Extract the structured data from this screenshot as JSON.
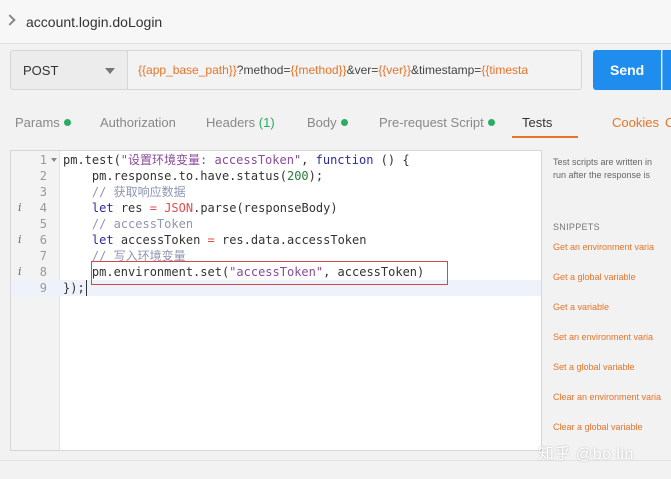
{
  "request": {
    "name": "account.login.doLogin"
  },
  "url_bar": {
    "method": "POST",
    "url_segments": [
      {
        "text": "{{app_base_path}}",
        "var": true
      },
      {
        "text": "?method=",
        "var": false
      },
      {
        "text": "{{method}}",
        "var": true
      },
      {
        "text": "&ver=",
        "var": false
      },
      {
        "text": "{{ver}}",
        "var": true
      },
      {
        "text": "&timestamp=",
        "var": false
      },
      {
        "text": "{{timesta",
        "var": true
      }
    ],
    "send_label": "Send"
  },
  "tabs": [
    {
      "label": "Params",
      "dot": true,
      "count": ""
    },
    {
      "label": "Authorization",
      "dot": false,
      "count": ""
    },
    {
      "label": "Headers",
      "dot": false,
      "count": "(1)"
    },
    {
      "label": "Body",
      "dot": true,
      "count": ""
    },
    {
      "label": "Pre-request Script",
      "dot": true,
      "count": ""
    },
    {
      "label": "Tests",
      "dot": false,
      "count": ""
    }
  ],
  "active_tab": "Tests",
  "cookies_label": "Cookies",
  "cookies_cut": "C",
  "editor": {
    "lines": [
      {
        "n": "1",
        "info": false,
        "fold": true
      },
      {
        "n": "2",
        "info": false,
        "fold": false
      },
      {
        "n": "3",
        "info": false,
        "fold": false
      },
      {
        "n": "4",
        "info": true,
        "fold": false
      },
      {
        "n": "5",
        "info": false,
        "fold": false
      },
      {
        "n": "6",
        "info": true,
        "fold": false
      },
      {
        "n": "7",
        "info": false,
        "fold": false
      },
      {
        "n": "8",
        "info": true,
        "fold": false
      },
      {
        "n": "9",
        "info": false,
        "fold": false
      }
    ],
    "code": {
      "l1a": "pm.test(",
      "l1b": "\"设置环境变量: accessToken\"",
      "l1c": ", ",
      "l1d": "function",
      "l1e": " () {",
      "l2a": "    pm.response.to.have.status(",
      "l2b": "200",
      "l2c": ");",
      "l3": "    // 获取响应数据",
      "l4a": "    ",
      "l4b": "let",
      "l4c": " res ",
      "l4d": "=",
      "l4e": " ",
      "l4f": "JSON",
      "l4g": ".parse(responseBody)",
      "l5": "    // accessToken",
      "l6a": "    ",
      "l6b": "let",
      "l6c": " accessToken ",
      "l6d": "=",
      "l6e": " res.data.accessToken",
      "l7": "    // 写入环境变量",
      "l8a": "    pm.environment.set(",
      "l8b": "\"accessToken\"",
      "l8c": ", accessToken)",
      "l9": "});"
    }
  },
  "sidebar": {
    "desc_line1": "Test scripts are written in",
    "desc_line2": "run after the response is",
    "snippets_heading": "SNIPPETS",
    "snippets": [
      "Get an environment varia",
      "Get a global variable",
      "Get a variable",
      "Set an environment varia",
      "Set a global variable",
      "Clear an environment varia",
      "Clear a global variable"
    ]
  },
  "watermark": "知乎 @bo lin",
  "colors": {
    "accent": "#e8742a",
    "send": "#1f8ded",
    "dot": "#27ae60",
    "highlight_box": "#d14a4a"
  }
}
